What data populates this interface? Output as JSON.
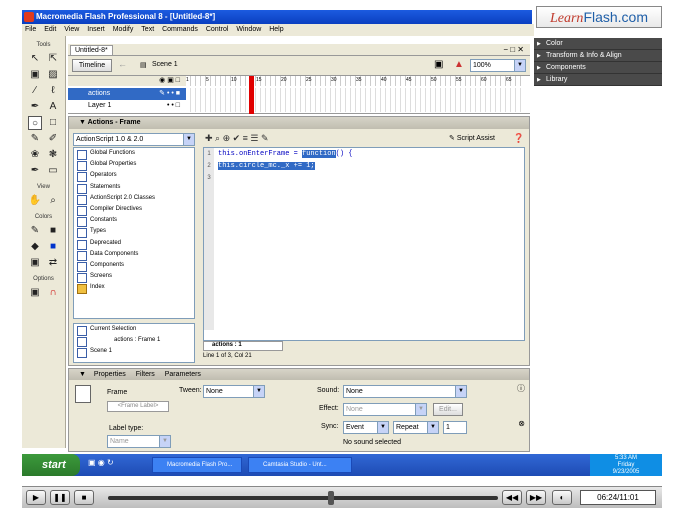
{
  "window": {
    "title": "Macromedia Flash Professional 8 - [Untitled-8*]"
  },
  "brand": {
    "prefix": "Learn",
    "suffix": "Flash.com"
  },
  "menu": [
    "File",
    "Edit",
    "View",
    "Insert",
    "Modify",
    "Text",
    "Commands",
    "Control",
    "Window",
    "Help"
  ],
  "tools": {
    "header": "Tools",
    "view": "View",
    "colors": "Colors",
    "options": "Options"
  },
  "doc": {
    "tab": "Untitled-8*",
    "timeline_button": "Timeline",
    "scene": "Scene 1",
    "zoom": "100%"
  },
  "timeline": {
    "ticks": [
      "1",
      "5",
      "10",
      "15",
      "20",
      "25",
      "30",
      "35",
      "40",
      "45",
      "50",
      "55",
      "60",
      "65"
    ],
    "layers": [
      "actions",
      "Layer 1"
    ]
  },
  "actions": {
    "title": "Actions - Frame",
    "version": "ActionScript 1.0 & 2.0",
    "script_assist": "Script Assist",
    "categories": [
      "Global Functions",
      "Global Properties",
      "Operators",
      "Statements",
      "ActionScript 2.0 Classes",
      "Compiler Directives",
      "Constants",
      "Types",
      "Deprecated",
      "Data Components",
      "Components",
      "Screens",
      "Index"
    ],
    "tree": [
      "Current Selection",
      "actions : Frame 1",
      "Scene 1"
    ],
    "code_line1_a": "this.onEnterFrame = ",
    "code_line1_b": "function",
    "code_line1_c": "() {",
    "code_line2": "this.circle_mc._x += 1;",
    "line_numbers": [
      "1",
      "2",
      "3"
    ],
    "tab": "actions : 1",
    "status": "Line 1 of 3, Col 21"
  },
  "props": {
    "tabs": [
      "Properties",
      "Filters",
      "Parameters"
    ],
    "frame": "Frame",
    "frame_label_placeholder": "<Frame Label>",
    "tween_label": "Tween:",
    "tween": "None",
    "sound_label": "Sound:",
    "sound": "None",
    "effect_label": "Effect:",
    "effect": "None",
    "edit": "Edit...",
    "sync_label": "Sync:",
    "sync": "Event",
    "repeat": "Repeat",
    "repeat_count": "1",
    "label_type": "Label type:",
    "label_type_value": "Name",
    "no_sound": "No sound selected"
  },
  "right_panels": [
    "Color",
    "Transform & Info & Align",
    "Components",
    "Library"
  ],
  "taskbar": {
    "start": "start",
    "tasks": [
      "Macromedia Flash Pro...",
      "Camtasia Studio - Unt..."
    ],
    "time": "5:33 AM",
    "day": "Friday",
    "date": "9/23/2005"
  },
  "player": {
    "timecode": "06:24/11:01"
  }
}
